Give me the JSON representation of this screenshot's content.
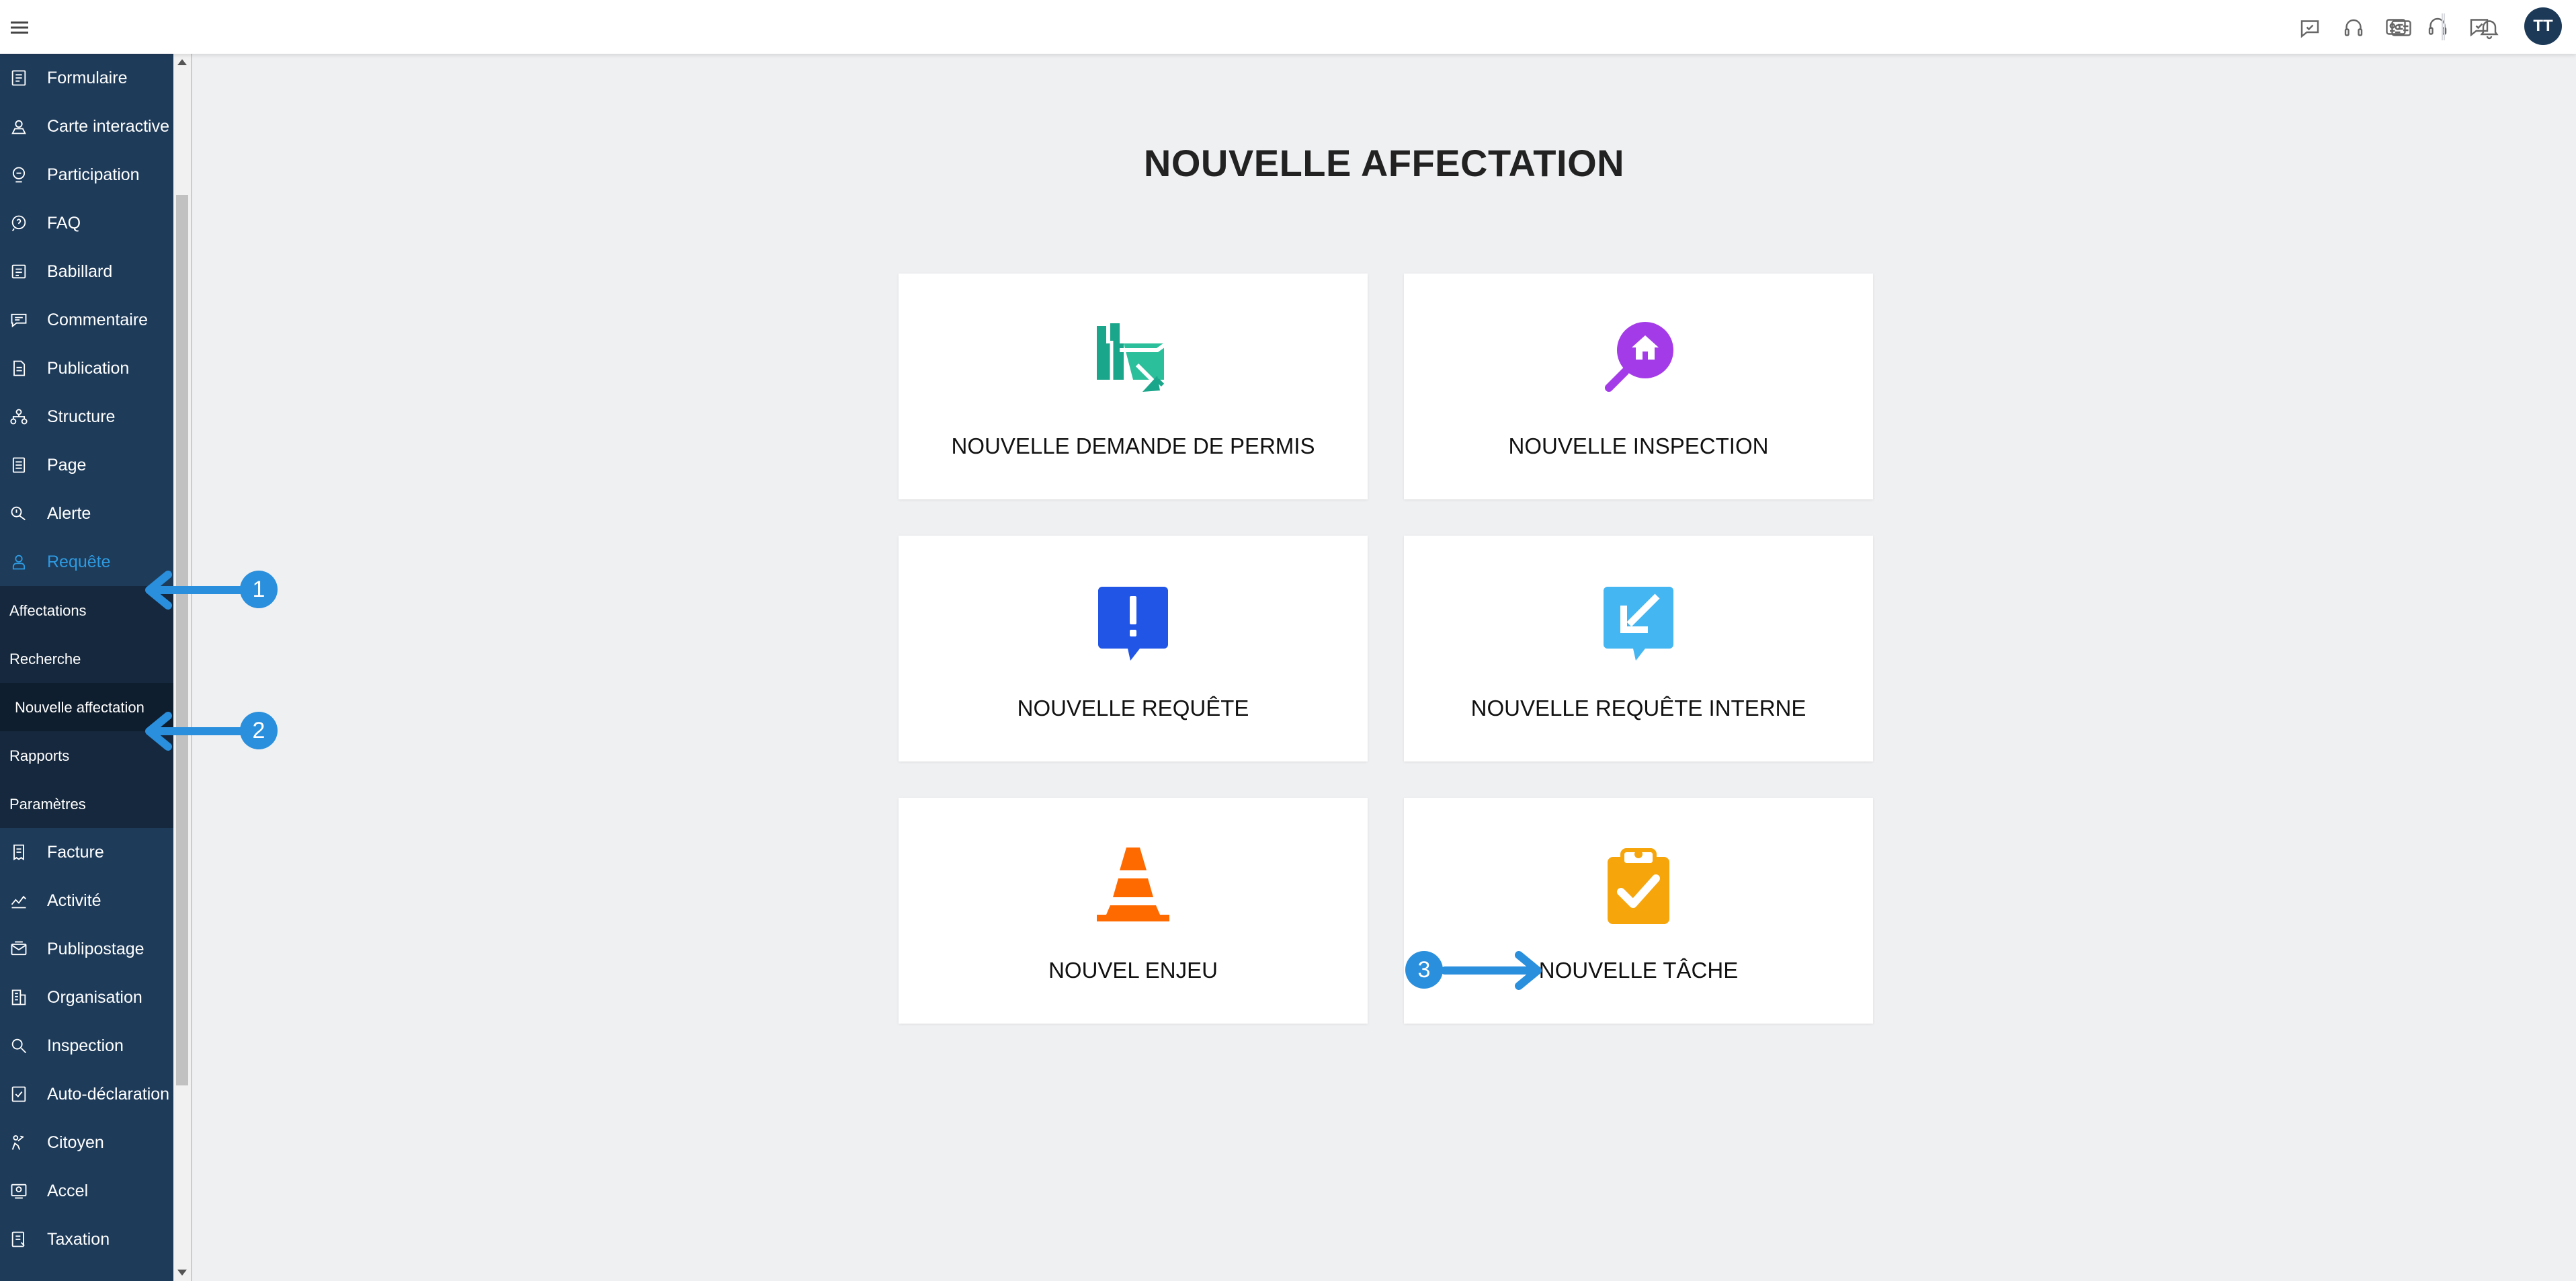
{
  "page": {
    "title": "NOUVELLE AFFECTATION"
  },
  "topbar": {
    "avatar_initials": "TT",
    "icons": [
      "chat-icon",
      "headset-icon",
      "id-card-icon",
      "bell-icon"
    ]
  },
  "sidebar": {
    "items": [
      {
        "label": "Formulaire",
        "icon": "form-icon"
      },
      {
        "label": "Carte interactive",
        "icon": "map-icon"
      },
      {
        "label": "Participation",
        "icon": "participation-icon"
      },
      {
        "label": "FAQ",
        "icon": "faq-icon"
      },
      {
        "label": "Babillard",
        "icon": "board-icon"
      },
      {
        "label": "Commentaire",
        "icon": "comment-icon"
      },
      {
        "label": "Publication",
        "icon": "publication-icon"
      },
      {
        "label": "Structure",
        "icon": "structure-icon"
      },
      {
        "label": "Page",
        "icon": "page-icon"
      },
      {
        "label": "Alerte",
        "icon": "alert-icon"
      },
      {
        "label": "Requête",
        "icon": "request-icon",
        "active": true
      }
    ],
    "subitems": [
      {
        "label": "Affectations"
      },
      {
        "label": "Recherche"
      },
      {
        "label": "Nouvelle affectation",
        "selected": true
      },
      {
        "label": "Rapports"
      },
      {
        "label": "Paramètres"
      }
    ],
    "items_after": [
      {
        "label": "Facture",
        "icon": "invoice-icon"
      },
      {
        "label": "Activité",
        "icon": "activity-icon"
      },
      {
        "label": "Publipostage",
        "icon": "mail-icon"
      },
      {
        "label": "Organisation",
        "icon": "organisation-icon"
      },
      {
        "label": "Inspection",
        "icon": "inspection-icon"
      },
      {
        "label": "Auto-déclaration",
        "icon": "self-declaration-icon"
      },
      {
        "label": "Citoyen",
        "icon": "citizen-icon"
      },
      {
        "label": "Accel",
        "icon": "accel-icon"
      },
      {
        "label": "Taxation",
        "icon": "taxation-icon"
      }
    ]
  },
  "cards": [
    {
      "label": "NOUVELLE DEMANDE DE PERMIS",
      "icon": "permit-map-icon",
      "color": "#1aa68a"
    },
    {
      "label": "NOUVELLE INSPECTION",
      "icon": "inspection-search-icon",
      "color": "#a43be8"
    },
    {
      "label": "NOUVELLE REQUÊTE",
      "icon": "request-exclamation-icon",
      "color": "#2155e6"
    },
    {
      "label": "NOUVELLE REQUÊTE INTERNE",
      "icon": "internal-request-icon",
      "color": "#44b6f2"
    },
    {
      "label": "NOUVEL ENJEU",
      "icon": "traffic-cone-icon",
      "color": "#ff6a00"
    },
    {
      "label": "NOUVELLE TÂCHE",
      "icon": "clipboard-check-icon",
      "color": "#f6a50a"
    }
  ],
  "annotations": [
    {
      "number": "1"
    },
    {
      "number": "2"
    },
    {
      "number": "3"
    }
  ],
  "colors": {
    "sidebar_bg": "#1e3b5a",
    "sidebar_sub_bg": "#16283d",
    "active_blue": "#2e9ae0",
    "annotation_blue": "#2a8fdc",
    "avatar_bg": "#1c3a58"
  }
}
